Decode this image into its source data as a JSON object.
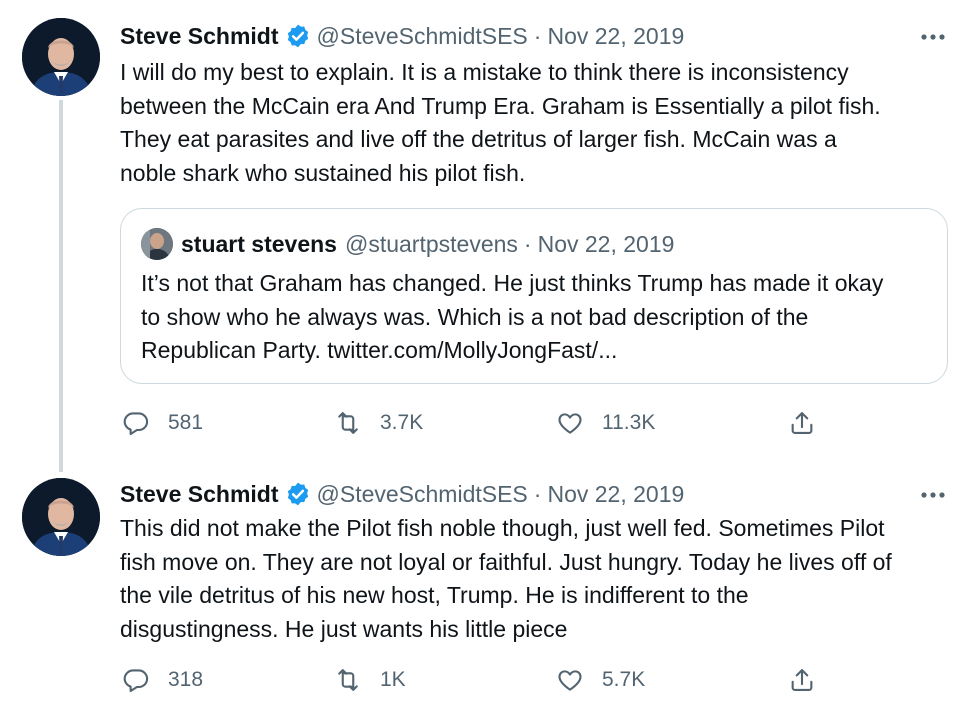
{
  "tweets": [
    {
      "author": {
        "name": "Steve Schmidt",
        "handle": "@SteveSchmidtSES",
        "verified": true
      },
      "separator": "·",
      "date": "Nov 22, 2019",
      "text": "I will do my best to explain. It is a mistake to think there is inconsistency\nbetween the McCain era And Trump Era. Graham is Essentially a pilot fish.\nThey eat parasites and live off the detritus of larger fish.  McCain was a\nnoble shark who sustained his pilot fish.",
      "quote": {
        "author": {
          "name": "stuart stevens",
          "handle": "@stuartpstevens"
        },
        "separator": "·",
        "date": "Nov 22, 2019",
        "text": "It’s not that Graham has changed. He just thinks Trump has made it okay\nto show who he always was. Which is a not bad description of the\nRepublican Party. twitter.com/MollyJongFast/..."
      },
      "stats": {
        "replies": "581",
        "retweets": "3.7K",
        "likes": "11.3K"
      }
    },
    {
      "author": {
        "name": "Steve Schmidt",
        "handle": "@SteveSchmidtSES",
        "verified": true
      },
      "separator": "·",
      "date": "Nov 22, 2019",
      "text": "This did not make the Pilot fish noble though, just well fed. Sometimes Pilot\nfish move on.  They are not loyal or faithful. Just hungry. Today he lives off of\nthe vile detritus of his new host, Trump. He is indifferent to the\ndisgustingness. He just wants his little piece",
      "stats": {
        "replies": "318",
        "retweets": "1K",
        "likes": "5.7K"
      }
    }
  ],
  "icons": {
    "verified": "verified-badge-icon",
    "more": "more-options-icon",
    "reply": "reply-icon",
    "retweet": "retweet-icon",
    "like": "heart-icon",
    "share": "share-icon"
  },
  "colors": {
    "text": "#0f1419",
    "secondary": "#536471",
    "verified": "#1d9bf0",
    "border": "#cfd9de"
  }
}
